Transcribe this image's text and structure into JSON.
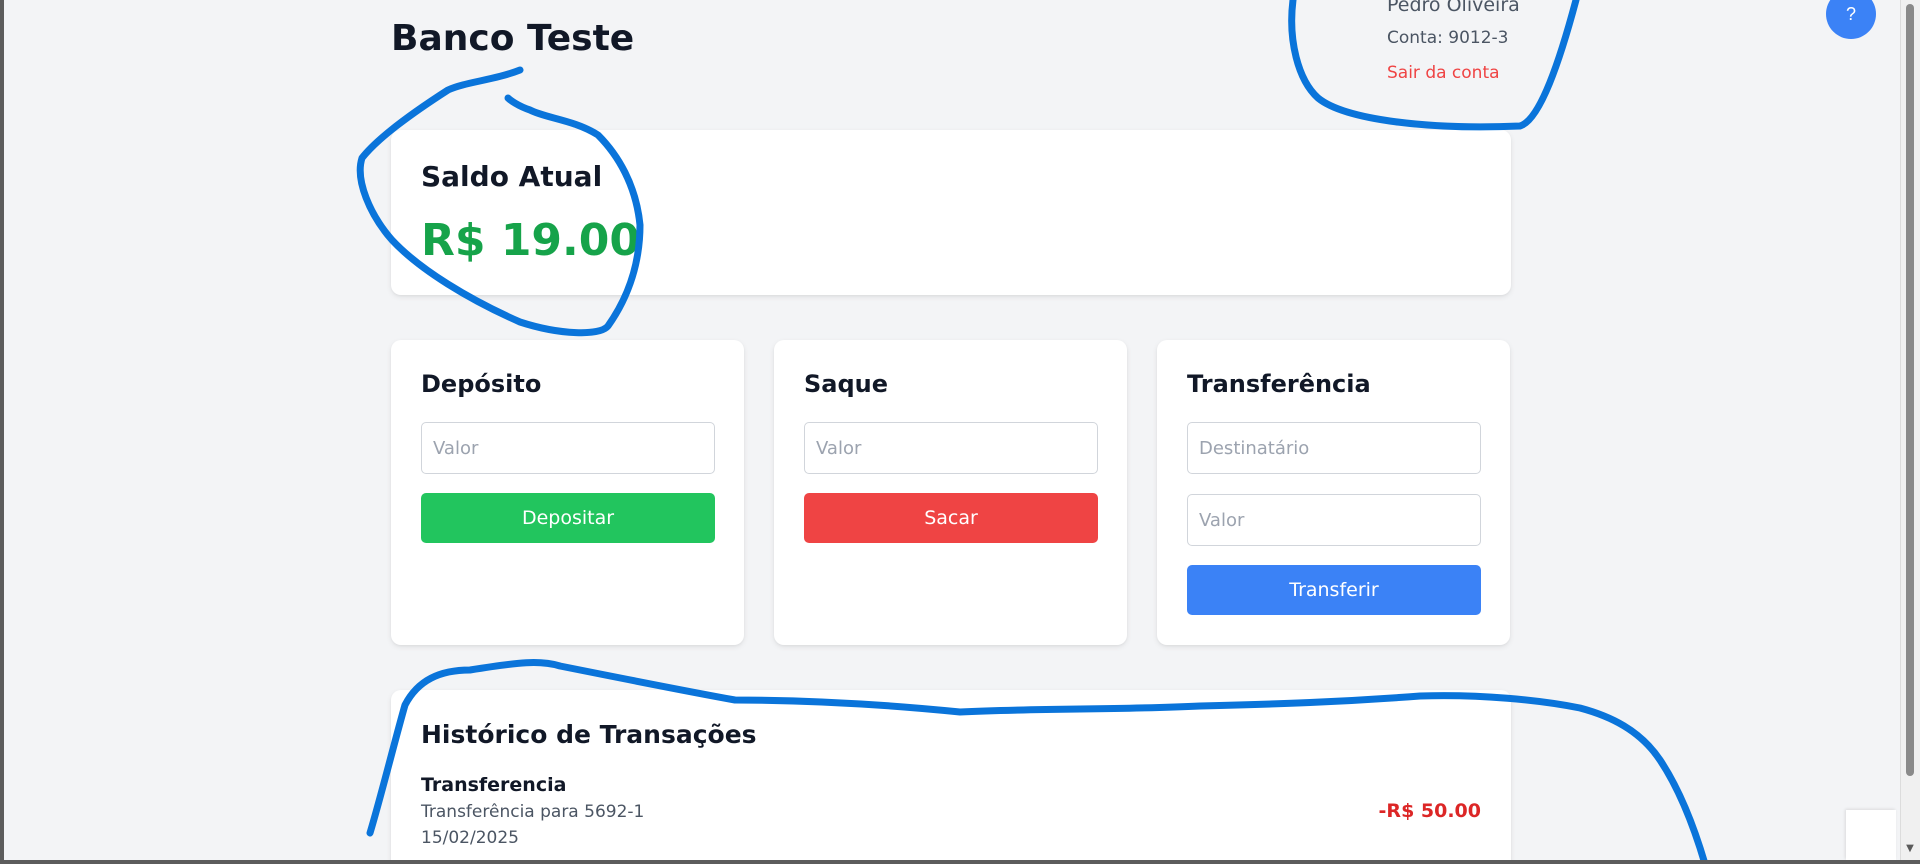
{
  "app": {
    "title": "Banco Teste"
  },
  "user": {
    "name": "Pedro Oliveira",
    "account": "Conta: 9012-3",
    "logout_label": "Sair da conta"
  },
  "help": {
    "label": "?"
  },
  "balance": {
    "label": "Saldo Atual",
    "value": "R$ 19.00"
  },
  "deposit": {
    "title": "Depósito",
    "amount_placeholder": "Valor",
    "button_label": "Depositar"
  },
  "withdraw": {
    "title": "Saque",
    "amount_placeholder": "Valor",
    "button_label": "Sacar"
  },
  "transfer": {
    "title": "Transferência",
    "recipient_placeholder": "Destinatário",
    "amount_placeholder": "Valor",
    "button_label": "Transferir"
  },
  "history": {
    "title": "Histórico de Transações",
    "transactions": [
      {
        "type": "Transferencia",
        "description": "Transferência para 5692-1",
        "date": "15/02/2025",
        "amount": "-R$ 50.00"
      }
    ]
  },
  "colors": {
    "balance": "#16a34a",
    "deposit_button": "#22c55e",
    "withdraw_button": "#ef4444",
    "transfer_button": "#3b82f6",
    "negative_amount": "#dc2626",
    "annotation_ink": "#0a74da"
  }
}
